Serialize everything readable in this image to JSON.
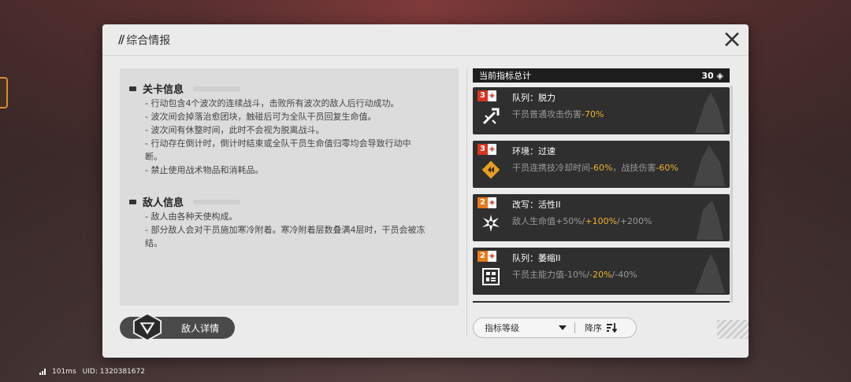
{
  "panel": {
    "title": "综合情报",
    "slashes": "//"
  },
  "stage_info": {
    "title": "关卡信息",
    "lines": [
      "- 行动包含4个波次的连续战斗，击败所有波次的敌人后行动成功。",
      "- 波次间会掉落治愈团块，触碰后可为全队干员回复生命值。",
      "- 波次间有休整时间，此时不会视为脱离战斗。",
      "- 行动存在倒计时，倒计时结束或全队干员生命值归零均会导致行动中",
      "断。",
      "- 禁止使用战术物品和消耗品。"
    ]
  },
  "enemy_info": {
    "title": "敌人信息",
    "lines": [
      "- 敌人由各种天使构成。",
      "- 部分敌人会对干员施加寒冷附着。寒冷附着层数叠满4层时，干员会被冻",
      "结。"
    ]
  },
  "enemy_button": {
    "label": "敌人详情"
  },
  "total": {
    "label": "当前指标总计",
    "value": "30",
    "unit": "◈"
  },
  "cards": [
    {
      "level": "3",
      "badge_color": "#d9341f",
      "title": "队列：脱力",
      "desc_pre": "干员普通攻击伤害",
      "hl1": "-70%",
      "desc_mid": "",
      "hl2": "",
      "desc_post": "",
      "icon": "sword-break-icon"
    },
    {
      "level": "3",
      "badge_color": "#d9341f",
      "title": "环境：过速",
      "desc_pre": "干员连携技冷却时间",
      "hl1": "-60%",
      "desc_mid": "，战技伤害",
      "hl2": "-60%",
      "desc_post": "",
      "icon": "speed-diamond-icon"
    },
    {
      "level": "2",
      "badge_color": "#e87a1c",
      "title": "改写：活性II",
      "desc_pre": "敌人生命值+50%/",
      "hl1": "+100%",
      "desc_mid": "/+200%",
      "hl2": "",
      "desc_post": "",
      "icon": "burst-icon"
    },
    {
      "level": "2",
      "badge_color": "#e87a1c",
      "title": "队列：萎缩II",
      "desc_pre": "干员主能力值-10%/",
      "hl1": "-20%",
      "desc_mid": "/-40%",
      "hl2": "",
      "desc_post": "",
      "icon": "grid-panel-icon"
    }
  ],
  "sort": {
    "selected": "指标等级",
    "order_label": "降序"
  },
  "status": {
    "ping": "101ms",
    "uid": "UID: 1320381672"
  }
}
